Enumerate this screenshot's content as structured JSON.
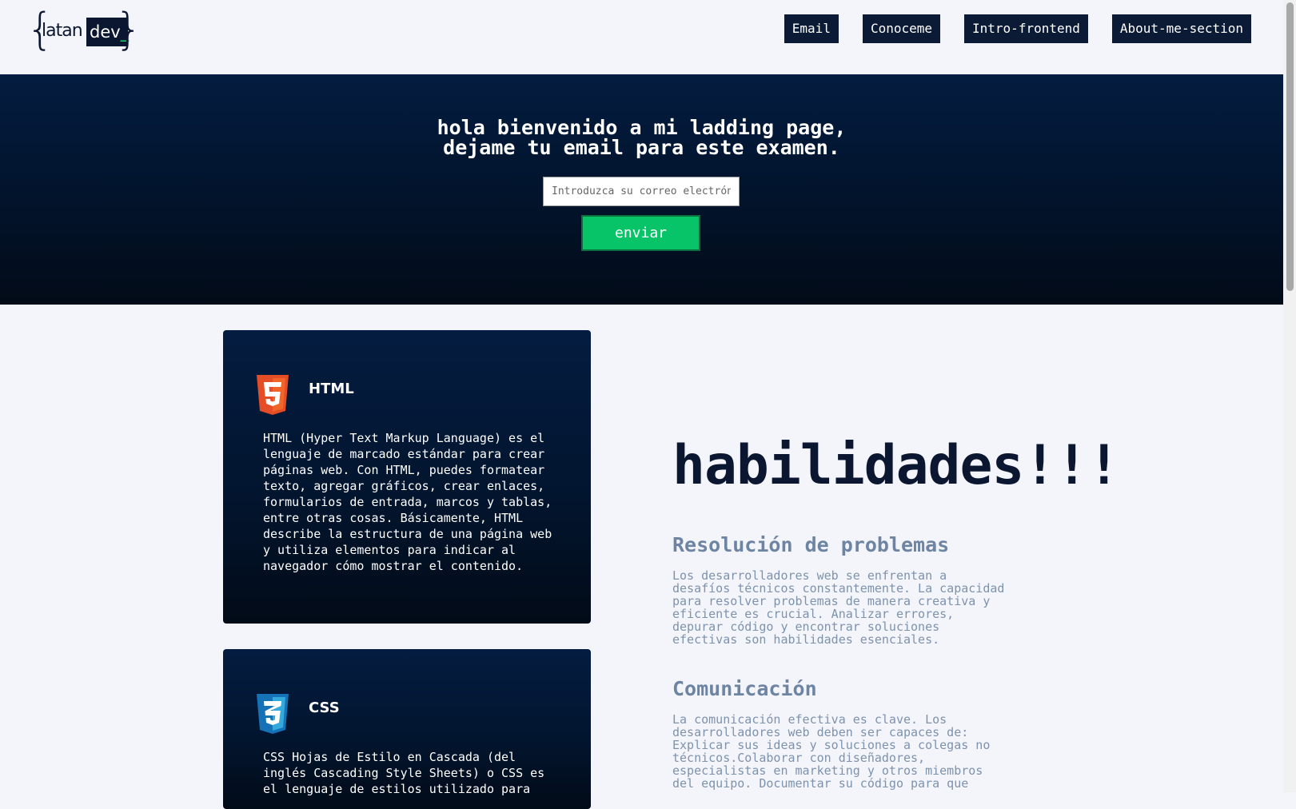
{
  "header": {
    "logo": {
      "word1": "latan",
      "word2": "dev",
      "cursor": "_"
    },
    "nav": [
      "Email",
      "Conoceme",
      "Intro-frontend",
      "About-me-section"
    ]
  },
  "hero": {
    "line1": "hola bienvenido a mi ladding page,",
    "line2": "dejame tu email para este examen.",
    "email_placeholder": "Introduzca su correo electrónico",
    "submit_label": "enviar"
  },
  "cards": [
    {
      "icon": "html5-icon",
      "title": "HTML",
      "text": "HTML (Hyper Text Markup Language) es el lenguaje de marcado estándar para crear páginas web. Con HTML, puedes formatear texto, agregar gráficos, crear enlaces, formularios de entrada, marcos y tablas, entre otras cosas. Básicamente, HTML describe la estructura de una página web y utiliza elementos para indicar al navegador cómo mostrar el contenido."
    },
    {
      "icon": "css3-icon",
      "title": "CSS",
      "text": "CSS Hojas de Estilo en Cascada (del inglés Cascading Style Sheets) o CSS es el lenguaje de estilos utilizado para"
    }
  ],
  "skills": {
    "title": "habilidades!!!",
    "items": [
      {
        "heading": "Resolución de problemas",
        "text": "Los desarrolladores web se enfrentan a desafíos técnicos constantemente. La capacidad para resolver problemas de manera creativa y eficiente es crucial. Analizar errores, depurar código y encontrar soluciones efectivas son habilidades esenciales."
      },
      {
        "heading": "Comunicación",
        "text": "La comunicación efectiva es clave. Los desarrolladores web deben ser capaces de: Explicar sus ideas y soluciones a colegas no técnicos.Colaborar con diseñadores, especialistas en marketing y otros miembros del equipo. Documentar su código para que"
      }
    ]
  },
  "colors": {
    "navy": "#0b1b36",
    "hero_top": "#041c40",
    "accent_green": "#07c468",
    "html_orange": "#e44d26",
    "css_blue": "#1572b6"
  }
}
